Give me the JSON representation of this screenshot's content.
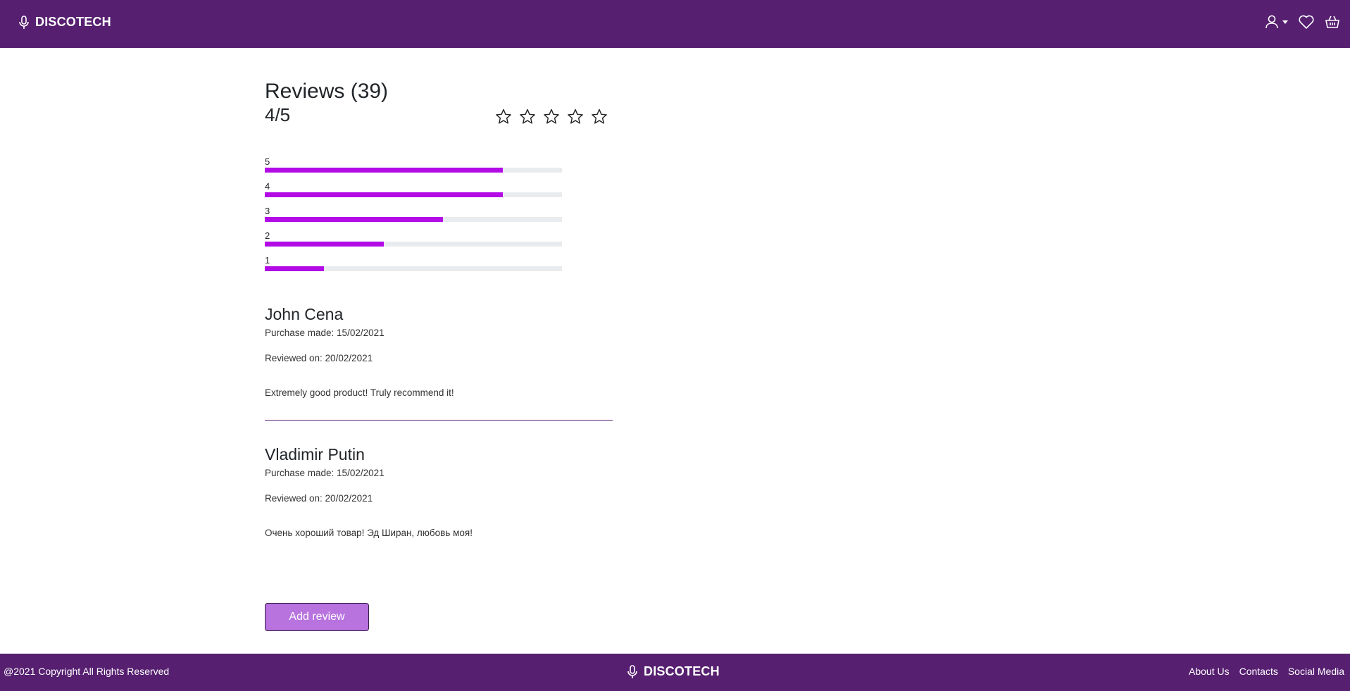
{
  "header": {
    "brand": "DISCOTECH",
    "icons": [
      "microphone-icon",
      "user-icon",
      "chevron-down-icon",
      "heart-icon",
      "basket-icon"
    ]
  },
  "reviews": {
    "title": "Reviews (39)",
    "rating": "4/5",
    "stars_filled": 0,
    "stars_total": 5,
    "distribution": [
      {
        "label": "5",
        "fraction": 0.8
      },
      {
        "label": "4",
        "fraction": 0.8
      },
      {
        "label": "3",
        "fraction": 0.6
      },
      {
        "label": "2",
        "fraction": 0.4
      },
      {
        "label": "1",
        "fraction": 0.2
      }
    ],
    "items": [
      {
        "name": "John Cena",
        "purchase": "Purchase made: 15/02/2021",
        "reviewed": "Reviewed on: 20/02/2021",
        "text": "Extremely good product! Truly recommend it!"
      },
      {
        "name": "Vladimir Putin",
        "purchase": "Purchase made: 15/02/2021",
        "reviewed": "Reviewed on: 20/02/2021",
        "text": "Очень хороший товар! Эд Ширан, любовь моя!"
      }
    ],
    "add_button": "Add review"
  },
  "footer": {
    "copyright": "@2021 Copyright All Rights Reserved",
    "brand": "DISCOTECH",
    "links": [
      "About Us",
      "Contacts",
      "Social Media"
    ]
  },
  "colors": {
    "brand_purple": "#561f70",
    "bar_fill": "#b30be6",
    "button_bg": "#b873df",
    "track": "#e9ecef"
  }
}
